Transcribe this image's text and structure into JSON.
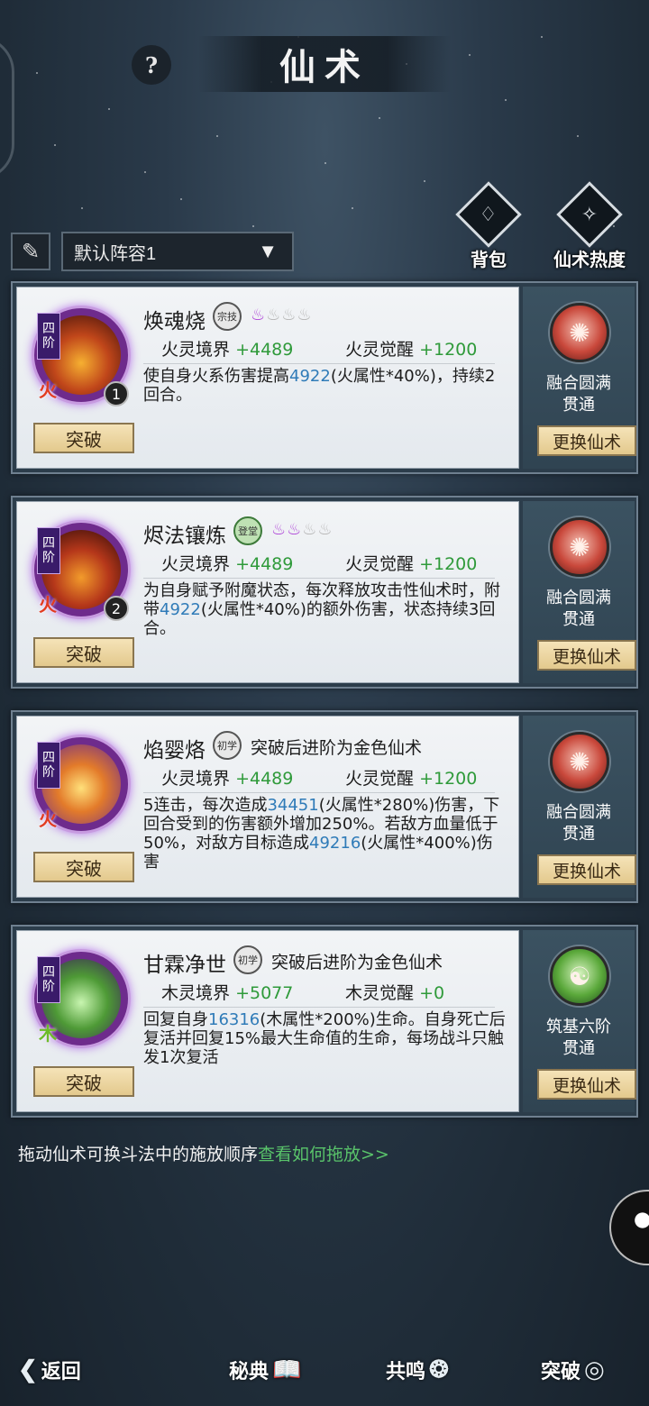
{
  "header": {
    "help_label": "?",
    "title": "仙术"
  },
  "lineup": {
    "brush_icon": "brush-icon",
    "selected": "默认阵容1"
  },
  "top_actions": [
    {
      "label": "背包",
      "icon": "bag-icon"
    },
    {
      "label": "仙术热度",
      "icon": "book-flame-icon"
    }
  ],
  "cards": [
    {
      "tier": [
        "四",
        "阶"
      ],
      "element": "火",
      "order": "1",
      "name": "焕魂烧",
      "rank": "宗技",
      "flames_on": 1,
      "flames_total": 4,
      "advance_note": "",
      "stat1_label": "火灵境界",
      "stat1_value": "+4489",
      "stat2_label": "火灵觉醒",
      "stat2_value": "+1200",
      "desc": [
        {
          "t": "使自身火系伤害提高"
        },
        {
          "t": "4922",
          "n": true
        },
        {
          "t": "(火属性*40%)，持续2回合。"
        }
      ],
      "break_label": "突破",
      "fusion_line1": "融合圆满",
      "fusion_line2": "贯通",
      "swap_label": "更换仙术"
    },
    {
      "tier": [
        "四",
        "阶"
      ],
      "element": "火",
      "order": "2",
      "name": "烬法镶炼",
      "rank": "登堂",
      "flames_on": 2,
      "flames_total": 4,
      "advance_note": "",
      "stat1_label": "火灵境界",
      "stat1_value": "+4489",
      "stat2_label": "火灵觉醒",
      "stat2_value": "+1200",
      "desc": [
        {
          "t": "为自身赋予附魔状态，每次释放攻击性仙术时，附带"
        },
        {
          "t": "4922",
          "n": true
        },
        {
          "t": "(火属性*40%)的额外伤害，状态持续3回合。"
        }
      ],
      "break_label": "突破",
      "fusion_line1": "融合圆满",
      "fusion_line2": "贯通",
      "swap_label": "更换仙术"
    },
    {
      "tier": [
        "四",
        "阶"
      ],
      "element": "火",
      "order": "",
      "name": "焰婴烙",
      "rank": "初学",
      "flames_on": 0,
      "flames_total": 0,
      "advance_note": "突破后进阶为金色仙术",
      "stat1_label": "火灵境界",
      "stat1_value": "+4489",
      "stat2_label": "火灵觉醒",
      "stat2_value": "+1200",
      "desc": [
        {
          "t": "5连击，每次造成"
        },
        {
          "t": "34451",
          "n": true
        },
        {
          "t": "(火属性*280%)伤害，下回合受到的伤害额外增加250%。若敌方血量低于50%，对敌方目标造成"
        },
        {
          "t": "49216",
          "n": true
        },
        {
          "t": "(火属性*400%)伤害"
        }
      ],
      "break_label": "突破",
      "fusion_line1": "融合圆满",
      "fusion_line2": "贯通",
      "swap_label": "更换仙术"
    },
    {
      "tier": [
        "四",
        "阶"
      ],
      "element": "木",
      "order": "",
      "name": "甘霖净世",
      "rank": "初学",
      "flames_on": 0,
      "flames_total": 0,
      "advance_note": "突破后进阶为金色仙术",
      "stat1_label": "木灵境界",
      "stat1_value": "+5077",
      "stat2_label": "木灵觉醒",
      "stat2_value": "+0",
      "desc": [
        {
          "t": "回复自身"
        },
        {
          "t": "16316",
          "n": true
        },
        {
          "t": "(木属性*200%)生命。自身死亡后复活并回复15%最大生命值的生命，每场战斗只触发1次复活"
        }
      ],
      "break_label": "突破",
      "fusion_line1": "筑基六阶",
      "fusion_line2": "贯通",
      "swap_label": "更换仙术"
    }
  ],
  "tip": {
    "text": "拖动仙术可换斗法中的施放顺序",
    "link": "查看如何拖放>>"
  },
  "bottom_nav": [
    {
      "label": "返回",
      "icon": "back-arrow-icon"
    },
    {
      "label": "秘典",
      "icon": "open-book-icon"
    },
    {
      "label": "共鸣",
      "icon": "swirl-icon"
    },
    {
      "label": "突破",
      "icon": "spiral-icon"
    }
  ]
}
